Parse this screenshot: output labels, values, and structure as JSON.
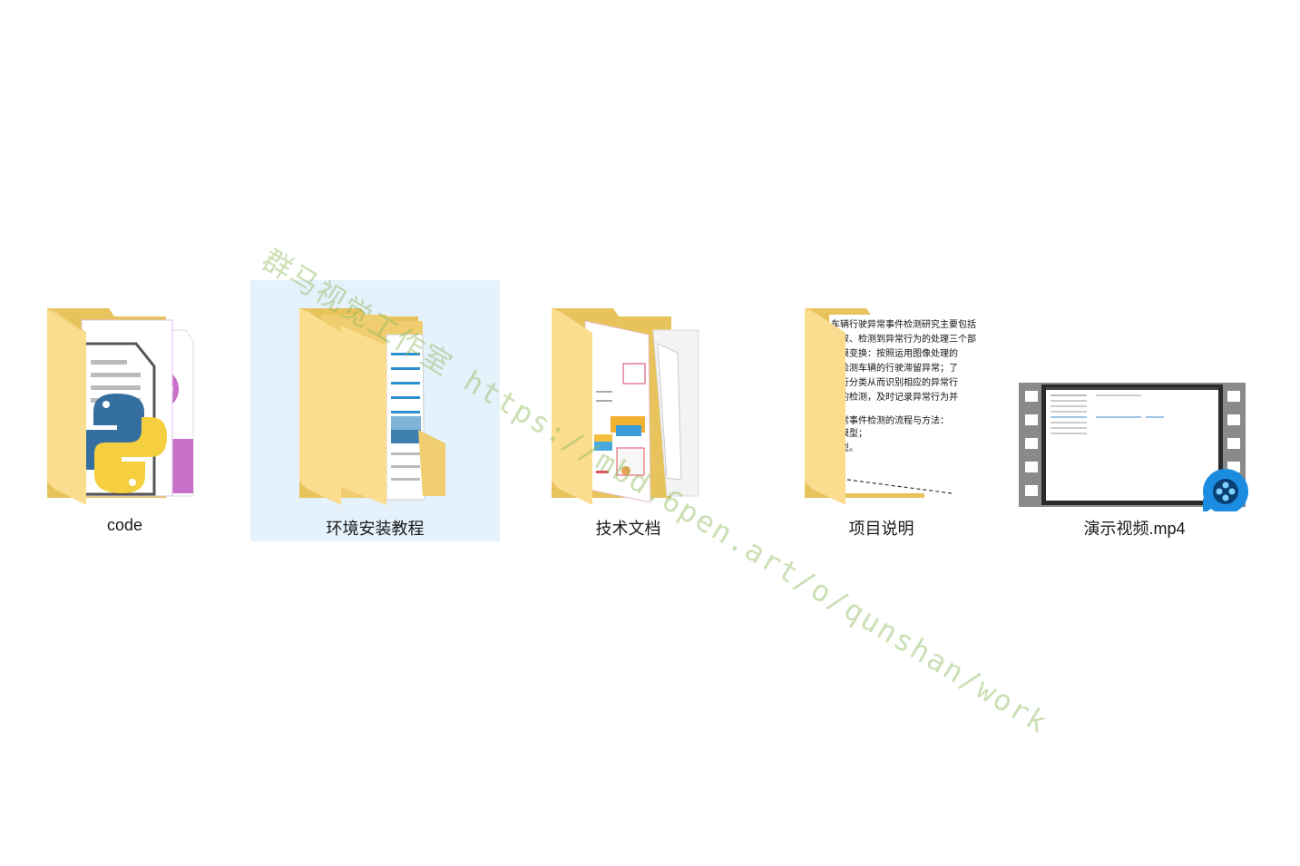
{
  "items": [
    {
      "label": "code",
      "icon": "python-folder-icon",
      "selected": false
    },
    {
      "label": "环境安装教程",
      "icon": "document-folder-icon",
      "selected": true
    },
    {
      "label": "技术文档",
      "icon": "pdf-folder-icon",
      "selected": false
    },
    {
      "label": "项目说明",
      "icon": "text-folder-icon",
      "selected": false
    },
    {
      "label": "演示视频.mp4",
      "icon": "video-file-icon",
      "selected": false
    }
  ],
  "watermark": {
    "text": "群马视觉工作室 https://mbd.6pen.art/o/qunshan/work"
  },
  "colors": {
    "folder_back": "#e8c25a",
    "folder_front": "#fbdd8f",
    "selection": "#e5f1fb",
    "video_badge": "#1c8ce0"
  },
  "preview_text": {
    "lines": [
      "车辆行驶异常事件检测研究主要包括",
      "提取、检测到异常行为的处理三个部",
      "速模变换：按照运用图像处理的",
      "，检测车辆的行驶滞留异常；了",
      "进行分类从而识别相应的异常行",
      "为的检测，及时记录异常行为并",
      "",
      "异常事件检测的流程与方法：",
      "的模型；",
      "模型。"
    ]
  }
}
